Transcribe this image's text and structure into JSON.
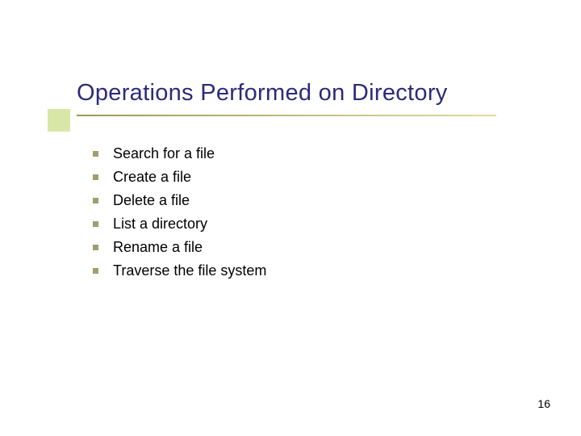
{
  "title": "Operations Performed on Directory",
  "items": [
    "Search for a file",
    "Create a file",
    "Delete a file",
    "List a directory",
    "Rename a file",
    "Traverse the file system"
  ],
  "page_number": "16"
}
